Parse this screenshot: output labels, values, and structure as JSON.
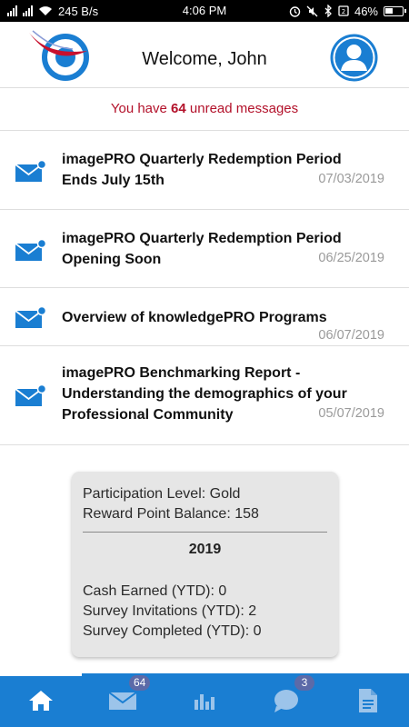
{
  "status_bar": {
    "network_speed": "245 B/s",
    "time": "4:06 PM",
    "battery": "46%"
  },
  "header": {
    "welcome": "Welcome, John"
  },
  "unread": {
    "prefix": "You have ",
    "count": "64",
    "suffix": " unread messages"
  },
  "messages": [
    {
      "title": "imagePRO Quarterly Redemption Period Ends July 15th",
      "date": "07/03/2019",
      "unread": true
    },
    {
      "title": "imagePRO Quarterly Redemption Period Opening Soon",
      "date": "06/25/2019",
      "unread": true
    },
    {
      "title": "Overview of knowledgePRO Programs",
      "date": "06/07/2019",
      "unread": true
    },
    {
      "title": "imagePRO Benchmarking Report - Understanding the demographics of your Professional Community",
      "date": "05/07/2019",
      "unread": true
    }
  ],
  "summary": {
    "participation": "Participation Level: Gold",
    "reward_balance": "Reward Point Balance: 158",
    "year": "2019",
    "cash_earned": "Cash Earned (YTD): 0",
    "survey_invitations": "Survey Invitations (YTD): 2",
    "survey_completed": "Survey Completed (YTD): 0"
  },
  "nav": {
    "items": [
      {
        "icon": "home-icon",
        "active": true
      },
      {
        "icon": "mail-icon",
        "badge": "64"
      },
      {
        "icon": "chart-icon"
      },
      {
        "icon": "chat-icon",
        "badge": "3"
      },
      {
        "icon": "document-icon"
      }
    ]
  },
  "colors": {
    "accent": "#1a7ed2",
    "unread_text": "#b3112a",
    "badge": "#5c6aa8"
  }
}
